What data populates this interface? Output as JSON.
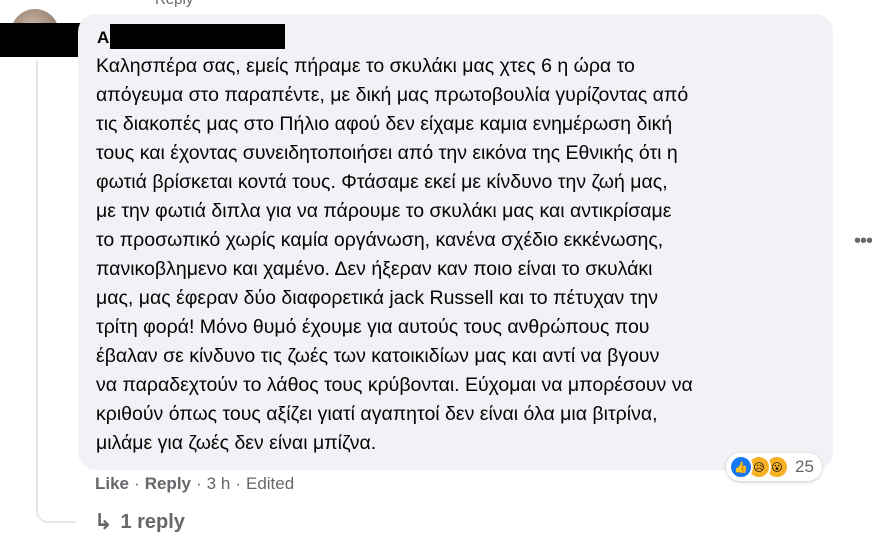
{
  "top_fragment": "Reply",
  "comment": {
    "author_initial": "A",
    "text": "Καλησπέρα σας, εμείς πήραμε το σκυλάκι μας χτες 6 η ώρα το\nαπόγευμα στο παραπέντε, με δική μας πρωτοβουλία γυρίζοντας από\nτις διακοπές μας στο Πήλιο αφού δεν είχαμε καμια ενημέρωση δική\nτους και έχοντας συνειδητοποιήσει από την εικόνα της Εθνικής ότι η\nφωτιά βρίσκεται κοντά τους. Φτάσαμε εκεί με κίνδυνο την ζωή μας,\nμε την φωτιά διπλα για να πάρουμε το σκυλάκι μας και αντικρίσαμε\nτο προσωπικό χωρίς καμία οργάνωση, κανένα σχέδιο εκκένωσης,\nπανικοβλημενο και χαμένο. Δεν ήξεραν καν ποιο είναι το σκυλάκι\nμας, μας έφεραν δύο διαφορετικά jack Russell και το πέτυχαν την\nτρίτη φορά! Μόνο θυμό έχουμε για αυτούς τους ανθρώπους που\nέβαλαν σε κίνδυνο τις ζωές των κατοικιδίων μας και αντί να βγουν\nνα παραδεχτούν το λάθος τους κρύβονται. Εύχομαι να μπορέσουν να\nκριθούν όπως τους αξίζει γιατί αγαπητοί δεν είναι όλα μια βιτρίνα,\nμιλάμε για ζωές δεν είναι μπίζνα.",
    "more_glyph": "•••",
    "reactions": {
      "icons": [
        "like-icon",
        "sad-icon",
        "wow-icon"
      ],
      "like_glyph": "👍",
      "sad_glyph": "😥",
      "wow_glyph": "😮",
      "count": "25"
    },
    "actions": {
      "like": "Like",
      "reply": "Reply",
      "time": "3 h",
      "edited": "Edited",
      "separator": "·"
    },
    "replies": {
      "icon": "reply-arrow-icon",
      "glyph": "↳",
      "label": "1 reply"
    }
  },
  "colors": {
    "bubble": "#f0f2f5",
    "secondary_text": "#65676b",
    "like_blue": "#1877f2",
    "emoji_yellow": "#f7b125"
  }
}
